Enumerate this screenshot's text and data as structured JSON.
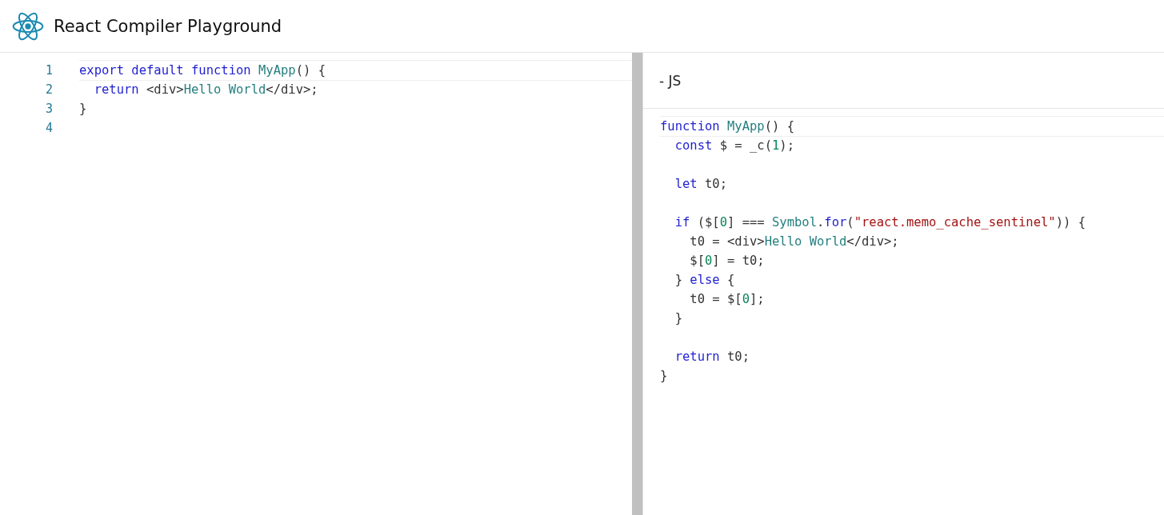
{
  "header": {
    "title": "React Compiler Playground"
  },
  "input_editor": {
    "lines": [
      {
        "number": "1",
        "tokens": [
          {
            "kind": "keyword",
            "text": "export default function"
          },
          {
            "kind": "name",
            "text": " MyApp"
          },
          {
            "kind": "plain",
            "text": "() {"
          }
        ]
      },
      {
        "number": "2",
        "tokens": [
          {
            "kind": "keyword",
            "text": "  return"
          },
          {
            "kind": "plain",
            "text": " <div>"
          },
          {
            "kind": "name",
            "text": "Hello World"
          },
          {
            "kind": "plain",
            "text": "</div>;"
          }
        ]
      },
      {
        "number": "3",
        "tokens": [
          {
            "kind": "plain",
            "text": "}"
          }
        ]
      },
      {
        "number": "4"
      }
    ]
  },
  "output_panel": {
    "title": "- JS",
    "blocks": [
      [
        {
          "tokens": [
            {
              "kind": "keyword",
              "text": "function"
            },
            {
              "kind": "name",
              "text": " MyApp"
            },
            {
              "kind": "plain",
              "text": "() {"
            }
          ]
        },
        {
          "tokens": [
            {
              "kind": "keyword",
              "text": "  const"
            },
            {
              "kind": "plain",
              "text": " $ = _c("
            },
            {
              "kind": "number",
              "text": "1"
            },
            {
              "kind": "plain",
              "text": ");"
            }
          ]
        }
      ],
      [
        {
          "tokens": [
            {
              "kind": "keyword",
              "text": "  let"
            },
            {
              "kind": "plain",
              "text": " t0;"
            }
          ]
        }
      ],
      [
        {
          "tokens": [
            {
              "kind": "keyword",
              "text": "  if"
            },
            {
              "kind": "plain",
              "text": " ($["
            },
            {
              "kind": "number",
              "text": "0"
            },
            {
              "kind": "plain",
              "text": "] === "
            },
            {
              "kind": "name",
              "text": "Symbol"
            },
            {
              "kind": "plain",
              "text": "."
            },
            {
              "kind": "keyword",
              "text": "for"
            },
            {
              "kind": "plain",
              "text": "("
            },
            {
              "kind": "string",
              "text": "\"react.memo_cache_sentinel\""
            },
            {
              "kind": "plain",
              "text": ")) {"
            }
          ]
        },
        {
          "tokens": [
            {
              "kind": "plain",
              "text": "    t0 = <div>"
            },
            {
              "kind": "name",
              "text": "Hello World"
            },
            {
              "kind": "plain",
              "text": "</div>;"
            }
          ]
        },
        {
          "tokens": [
            {
              "kind": "plain",
              "text": "    $["
            },
            {
              "kind": "number",
              "text": "0"
            },
            {
              "kind": "plain",
              "text": "] = t0;"
            }
          ]
        },
        {
          "tokens": [
            {
              "kind": "plain",
              "text": "  } "
            },
            {
              "kind": "keyword",
              "text": "else"
            },
            {
              "kind": "plain",
              "text": " {"
            }
          ]
        },
        {
          "tokens": [
            {
              "kind": "plain",
              "text": "    t0 = $["
            },
            {
              "kind": "number",
              "text": "0"
            },
            {
              "kind": "plain",
              "text": "];"
            }
          ]
        },
        {
          "tokens": [
            {
              "kind": "plain",
              "text": "  }"
            }
          ]
        }
      ],
      [
        {
          "tokens": [
            {
              "kind": "keyword",
              "text": "  return"
            },
            {
              "kind": "plain",
              "text": " t0;"
            }
          ]
        },
        {
          "tokens": [
            {
              "kind": "plain",
              "text": "}"
            }
          ]
        }
      ]
    ]
  }
}
